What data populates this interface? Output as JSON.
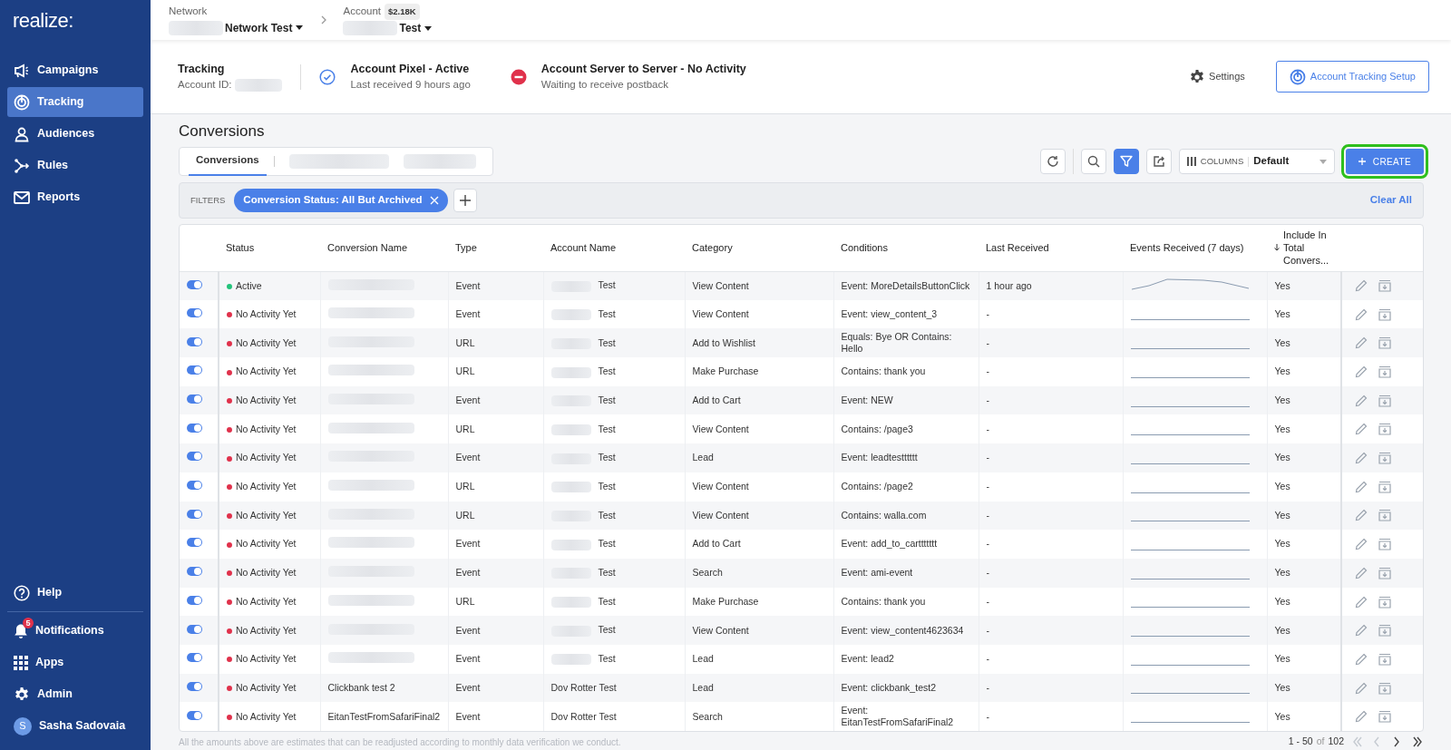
{
  "sidebar": {
    "logo": "realize:",
    "items": [
      {
        "label": "Campaigns",
        "selected": false
      },
      {
        "label": "Tracking",
        "selected": true
      },
      {
        "label": "Audiences",
        "selected": false
      },
      {
        "label": "Rules",
        "selected": false
      },
      {
        "label": "Reports",
        "selected": false
      }
    ],
    "bottom_items": [
      {
        "label": "Help"
      },
      {
        "label": "Notifications",
        "badge": "5"
      },
      {
        "label": "Apps"
      },
      {
        "label": "Admin"
      },
      {
        "label": "Sasha Sadovaia",
        "avatar_letter": "S"
      }
    ]
  },
  "header": {
    "network": {
      "label": "Network",
      "value": "Network Test",
      "blurred_prefix": true
    },
    "account": {
      "label": "Account",
      "badge": "$2.18K",
      "value": "Test",
      "blurred_prefix": true
    }
  },
  "tracking": {
    "title": "Tracking",
    "account_id_label": "Account ID:",
    "account_id_blurred": true,
    "statuses": [
      {
        "kind": "ok",
        "title": "Account Pixel - Active",
        "subtitle": "Last received 9 hours ago"
      },
      {
        "kind": "error",
        "title": "Account Server to Server - No Activity",
        "subtitle": "Waiting to receive postback"
      }
    ],
    "settings": "Settings",
    "setup_button": "Account Tracking Setup"
  },
  "page_title": "Conversions",
  "tabs": [
    {
      "label": "Conversions",
      "selected": true,
      "blurred": false
    },
    {
      "selected": false,
      "blurred": true
    },
    {
      "selected": false,
      "blurred": true
    }
  ],
  "toolbar": {
    "buttons": [
      {
        "kind": "refresh",
        "selected": false
      },
      {
        "kind": "search",
        "selected": false
      },
      {
        "kind": "filter",
        "selected": true
      },
      {
        "kind": "share",
        "selected": false
      }
    ],
    "columns_label": "COLUMNS",
    "columns_value": "Default",
    "create_button": "CREATE",
    "create_highlighted": true
  },
  "filters": {
    "label": "FILTERS",
    "chips": [
      "Conversion Status: All But Archived"
    ],
    "clear": "Clear All"
  },
  "table": {
    "columns": [
      {
        "label": "Status",
        "sorted": false
      },
      {
        "label": "Conversion Name",
        "sorted": false
      },
      {
        "label": "Type",
        "sorted": false
      },
      {
        "label": "Account Name",
        "sorted": false
      },
      {
        "label": "Category",
        "sorted": false
      },
      {
        "label": "Conditions",
        "sorted": false
      },
      {
        "label": "Last Received",
        "sorted": false
      },
      {
        "label": "Events Received (7 days)",
        "sorted": false
      },
      {
        "label": "Include In Total Convers...",
        "sorted": true
      }
    ],
    "rows": [
      {
        "kind": "active",
        "on": true,
        "status": "Active",
        "color": "#22c37a",
        "name_blurred": true,
        "type": "Event",
        "account_blurred": true,
        "account": "Test",
        "category": "View Content",
        "conditions": "Event: MoreDetailsButtonClick",
        "last_received": "1 hour ago",
        "include": "Yes"
      },
      {
        "kind": "idle",
        "on": true,
        "status": "No Activity Yet",
        "color": "#e0314b",
        "name_blurred": true,
        "type": "Event",
        "account_blurred": true,
        "account": "Test",
        "category": "View Content",
        "conditions": "Event: view_content_3",
        "last_received": "-",
        "include": "Yes"
      },
      {
        "kind": "idle",
        "on": true,
        "status": "No Activity Yet",
        "color": "#e0314b",
        "name_blurred": true,
        "type": "URL",
        "account_blurred": true,
        "account": "Test",
        "category": "Add to Wishlist",
        "conditions": "Equals: Bye OR Contains: Hello",
        "last_received": "-",
        "include": "Yes"
      },
      {
        "kind": "idle",
        "on": true,
        "status": "No Activity Yet",
        "color": "#e0314b",
        "name_blurred": true,
        "type": "URL",
        "account_blurred": true,
        "account": "Test",
        "category": "Make Purchase",
        "conditions": "Contains: thank you",
        "last_received": "-",
        "include": "Yes"
      },
      {
        "kind": "idle",
        "on": true,
        "status": "No Activity Yet",
        "color": "#e0314b",
        "name_blurred": true,
        "type": "Event",
        "account_blurred": true,
        "account": "Test",
        "category": "Add to Cart",
        "conditions": "Event: NEW",
        "last_received": "-",
        "include": "Yes"
      },
      {
        "kind": "idle",
        "on": true,
        "status": "No Activity Yet",
        "color": "#e0314b",
        "name_blurred": true,
        "type": "URL",
        "account_blurred": true,
        "account": "Test",
        "category": "View Content",
        "conditions": "Contains: /page3",
        "last_received": "-",
        "include": "Yes"
      },
      {
        "kind": "idle",
        "on": true,
        "status": "No Activity Yet",
        "color": "#e0314b",
        "name_blurred": true,
        "type": "Event",
        "account_blurred": true,
        "account": "Test",
        "category": "Lead",
        "conditions": "Event: leadtestttttt",
        "last_received": "-",
        "include": "Yes"
      },
      {
        "kind": "idle",
        "on": true,
        "status": "No Activity Yet",
        "color": "#e0314b",
        "name_blurred": true,
        "type": "URL",
        "account_blurred": true,
        "account": "Test",
        "category": "View Content",
        "conditions": "Contains: /page2",
        "last_received": "-",
        "include": "Yes"
      },
      {
        "kind": "idle",
        "on": true,
        "status": "No Activity Yet",
        "color": "#e0314b",
        "name_blurred": true,
        "type": "URL",
        "account_blurred": true,
        "account": "Test",
        "category": "View Content",
        "conditions": "Contains: walla.com",
        "last_received": "-",
        "include": "Yes"
      },
      {
        "kind": "idle",
        "on": true,
        "status": "No Activity Yet",
        "color": "#e0314b",
        "name_blurred": true,
        "type": "Event",
        "account_blurred": true,
        "account": "Test",
        "category": "Add to Cart",
        "conditions": "Event: add_to_carttttttt",
        "last_received": "-",
        "include": "Yes"
      },
      {
        "kind": "idle",
        "on": true,
        "status": "No Activity Yet",
        "color": "#e0314b",
        "name_blurred": true,
        "type": "Event",
        "account_blurred": true,
        "account": "Test",
        "category": "Search",
        "conditions": "Event: ami-event",
        "last_received": "-",
        "include": "Yes"
      },
      {
        "kind": "idle",
        "on": true,
        "status": "No Activity Yet",
        "color": "#e0314b",
        "name_blurred": true,
        "type": "URL",
        "account_blurred": true,
        "account": "Test",
        "category": "Make Purchase",
        "conditions": "Contains: thank you",
        "last_received": "-",
        "include": "Yes"
      },
      {
        "kind": "idle",
        "on": true,
        "status": "No Activity Yet",
        "color": "#e0314b",
        "name_blurred": true,
        "type": "Event",
        "account_blurred": true,
        "account": "Test",
        "category": "View Content",
        "conditions": "Event: view_content4623634",
        "last_received": "-",
        "include": "Yes"
      },
      {
        "kind": "idle",
        "on": true,
        "status": "No Activity Yet",
        "color": "#e0314b",
        "name_blurred": true,
        "type": "Event",
        "account_blurred": true,
        "account": "Test",
        "category": "Lead",
        "conditions": "Event: lead2",
        "last_received": "-",
        "include": "Yes"
      },
      {
        "kind": "idle",
        "on": true,
        "status": "No Activity Yet",
        "color": "#e0314b",
        "name_blurred": false,
        "name": "Clickbank test 2",
        "type": "Event",
        "account_blurred": false,
        "account": "Dov Rotter Test",
        "category": "Lead",
        "conditions": "Event: clickbank_test2",
        "last_received": "-",
        "include": "Yes"
      },
      {
        "kind": "idle",
        "on": true,
        "status": "No Activity Yet",
        "color": "#e0314b",
        "name_blurred": false,
        "name": "EitanTestFromSafariFinal2",
        "type": "Event",
        "account_blurred": false,
        "account": "Dov Rotter Test",
        "category": "Search",
        "conditions": "Event: EitanTestFromSafariFinal2",
        "last_received": "-",
        "include": "Yes"
      }
    ]
  },
  "footer": {
    "note": "All the amounts above are estimates that can be readjusted according to monthly data verification we conduct.",
    "range": "1 - 50",
    "of": "of",
    "total": "102",
    "pager": [
      {
        "kind": "first",
        "disabled": true
      },
      {
        "kind": "prev",
        "disabled": true
      },
      {
        "kind": "next",
        "disabled": false
      },
      {
        "kind": "last",
        "disabled": false
      }
    ]
  }
}
